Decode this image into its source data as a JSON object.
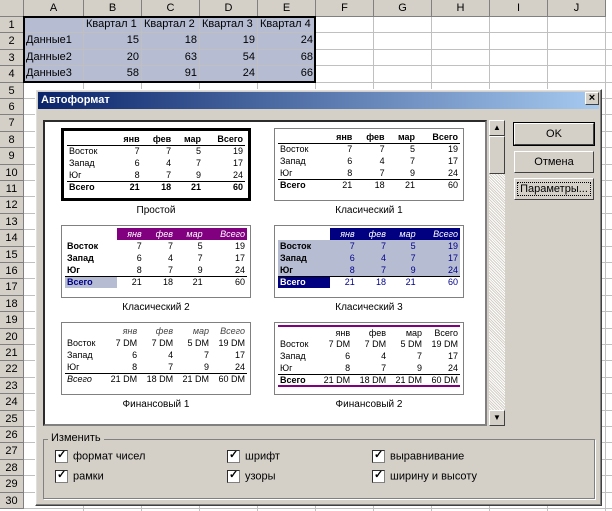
{
  "spreadsheet": {
    "columns": [
      "A",
      "B",
      "C",
      "D",
      "E",
      "F",
      "G",
      "H",
      "I",
      "J"
    ],
    "rows": [
      "1",
      "2",
      "3",
      "4",
      "5",
      "6",
      "7",
      "8",
      "9",
      "10",
      "11",
      "12",
      "13",
      "14",
      "15",
      "16",
      "17",
      "18",
      "19",
      "20",
      "21",
      "22",
      "23",
      "24",
      "25",
      "26",
      "27",
      "28",
      "29",
      "30"
    ],
    "header_row": [
      "",
      "Квартал 1",
      "Квартал 2",
      "Квартал 3",
      "Квартал 4"
    ],
    "data": [
      [
        "Данные1",
        "15",
        "18",
        "19",
        "24"
      ],
      [
        "Данные2",
        "20",
        "63",
        "54",
        "68"
      ],
      [
        "Данные3",
        "58",
        "91",
        "24",
        "66"
      ]
    ]
  },
  "dialog": {
    "title": "Автоформат",
    "close": "×",
    "ok": "OK",
    "cancel": "Отмена",
    "options": "Параметры...",
    "group_title": "Изменить",
    "checks": [
      "формат чисел",
      "шрифт",
      "выравнивание",
      "рамки",
      "узоры",
      "ширину и высоту"
    ],
    "formats": [
      {
        "name": "Простой",
        "head": [
          "",
          "янв",
          "фев",
          "мар",
          "Всего"
        ],
        "rows": [
          [
            "Восток",
            "7",
            "7",
            "5",
            "19"
          ],
          [
            "Запад",
            "6",
            "4",
            "7",
            "17"
          ],
          [
            "Юг",
            "8",
            "7",
            "9",
            "24"
          ],
          [
            "Всего",
            "21",
            "18",
            "21",
            "60"
          ]
        ]
      },
      {
        "name": "Класический 1",
        "head": [
          "",
          "янв",
          "фев",
          "мар",
          "Всего"
        ],
        "rows": [
          [
            "Восток",
            "7",
            "7",
            "5",
            "19"
          ],
          [
            "Запад",
            "6",
            "4",
            "7",
            "17"
          ],
          [
            "Юг",
            "8",
            "7",
            "9",
            "24"
          ],
          [
            "Всего",
            "21",
            "18",
            "21",
            "60"
          ]
        ]
      },
      {
        "name": "Класический 2",
        "head": [
          "",
          "янв",
          "фев",
          "мар",
          "Всего"
        ],
        "rows": [
          [
            "Восток",
            "7",
            "7",
            "5",
            "19"
          ],
          [
            "Запад",
            "6",
            "4",
            "7",
            "17"
          ],
          [
            "Юг",
            "8",
            "7",
            "9",
            "24"
          ],
          [
            "Всего",
            "21",
            "18",
            "21",
            "60"
          ]
        ]
      },
      {
        "name": "Класический 3",
        "head": [
          "",
          "янв",
          "фев",
          "мар",
          "Всего"
        ],
        "rows": [
          [
            "Восток",
            "7",
            "7",
            "5",
            "19"
          ],
          [
            "Запад",
            "6",
            "4",
            "7",
            "17"
          ],
          [
            "Юг",
            "8",
            "7",
            "9",
            "24"
          ],
          [
            "Всего",
            "21",
            "18",
            "21",
            "60"
          ]
        ]
      },
      {
        "name": "Финансовый 1",
        "head": [
          "",
          "янв",
          "фев",
          "мар",
          "Всего"
        ],
        "rows": [
          [
            "Восток",
            "7 DM",
            "7 DM",
            "5 DM",
            "19 DM"
          ],
          [
            "Запад",
            "6",
            "4",
            "7",
            "17"
          ],
          [
            "Юг",
            "8",
            "7",
            "9",
            "24"
          ],
          [
            "Всего",
            "21 DM",
            "18 DM",
            "21 DM",
            "60 DM"
          ]
        ]
      },
      {
        "name": "Финансовый 2",
        "head": [
          "",
          "янв",
          "фев",
          "мар",
          "Всего"
        ],
        "rows": [
          [
            "Восток",
            "7 DM",
            "7 DM",
            "5 DM",
            "19 DM"
          ],
          [
            "Запад",
            "6",
            "4",
            "7",
            "17"
          ],
          [
            "Юг",
            "8",
            "7",
            "9",
            "24"
          ],
          [
            "Всего",
            "21 DM",
            "18 DM",
            "21 DM",
            "60 DM"
          ]
        ]
      }
    ]
  }
}
